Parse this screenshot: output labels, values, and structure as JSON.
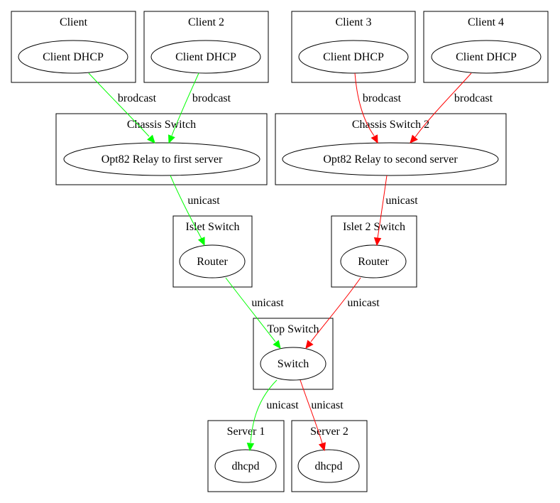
{
  "clusters": [
    {
      "id": "client",
      "label": "Client",
      "node": "Client DHCP"
    },
    {
      "id": "client2",
      "label": "Client 2",
      "node": "Client DHCP"
    },
    {
      "id": "client3",
      "label": "Client 3",
      "node": "Client DHCP"
    },
    {
      "id": "client4",
      "label": "Client 4",
      "node": "Client DHCP"
    },
    {
      "id": "chassis",
      "label": "Chassis Switch",
      "node": "Opt82 Relay to first server"
    },
    {
      "id": "chassis2",
      "label": "Chassis Switch 2",
      "node": "Opt82 Relay to second server"
    },
    {
      "id": "islet",
      "label": "Islet Switch",
      "node": "Router"
    },
    {
      "id": "islet2",
      "label": "Islet 2 Switch",
      "node": "Router"
    },
    {
      "id": "top",
      "label": "Top Switch",
      "node": "Switch"
    },
    {
      "id": "server1",
      "label": "Server 1",
      "node": "dhcpd"
    },
    {
      "id": "server2",
      "label": "Server 2",
      "node": "dhcpd"
    }
  ],
  "edges": [
    {
      "from": "client",
      "to": "chassis",
      "label": "brodcast",
      "color": "#00ff00"
    },
    {
      "from": "client2",
      "to": "chassis",
      "label": "brodcast",
      "color": "#00ff00"
    },
    {
      "from": "client3",
      "to": "chassis2",
      "label": "brodcast",
      "color": "#ff0000"
    },
    {
      "from": "client4",
      "to": "chassis2",
      "label": "brodcast",
      "color": "#ff0000"
    },
    {
      "from": "chassis",
      "to": "islet",
      "label": "unicast",
      "color": "#00ff00"
    },
    {
      "from": "chassis2",
      "to": "islet2",
      "label": "unicast",
      "color": "#ff0000"
    },
    {
      "from": "islet",
      "to": "top",
      "label": "unicast",
      "color": "#00ff00"
    },
    {
      "from": "islet2",
      "to": "top",
      "label": "unicast",
      "color": "#ff0000"
    },
    {
      "from": "top",
      "to": "server1",
      "label": "unicast",
      "color": "#00ff00"
    },
    {
      "from": "top",
      "to": "server2",
      "label": "unicast",
      "color": "#ff0000"
    }
  ]
}
